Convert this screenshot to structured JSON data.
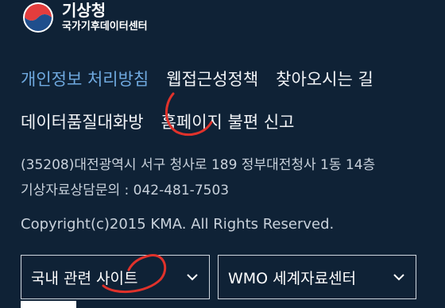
{
  "header": {
    "org_name": "기상청",
    "org_sub": "국가기후데이터센터",
    "logo_icon": "kma-emblem-icon"
  },
  "nav": {
    "items": [
      {
        "label": "개인정보 처리방침",
        "highlight": true
      },
      {
        "label": "웹접근성정책"
      },
      {
        "label": "찾아오시는 길"
      },
      {
        "label": "데이터품질대화방"
      },
      {
        "label": "홈페이지 불편 신고"
      }
    ]
  },
  "footer": {
    "address": "(35208)대전광역시 서구 청사로 189 정부대전청사 1동 14층",
    "contact": "기상자료상담문의 : 042-481-7503",
    "copyright": "Copyright(c)2015 KMA. All Rights Reserved."
  },
  "selects": {
    "domestic": "국내 관련 사이트",
    "wmo": "WMO 세계자료센터",
    "chevron_icon": "chevron-down-icon"
  },
  "colors": {
    "background": "#0f2236",
    "highlight": "#6fa9df",
    "annotation": "#e0322b"
  }
}
